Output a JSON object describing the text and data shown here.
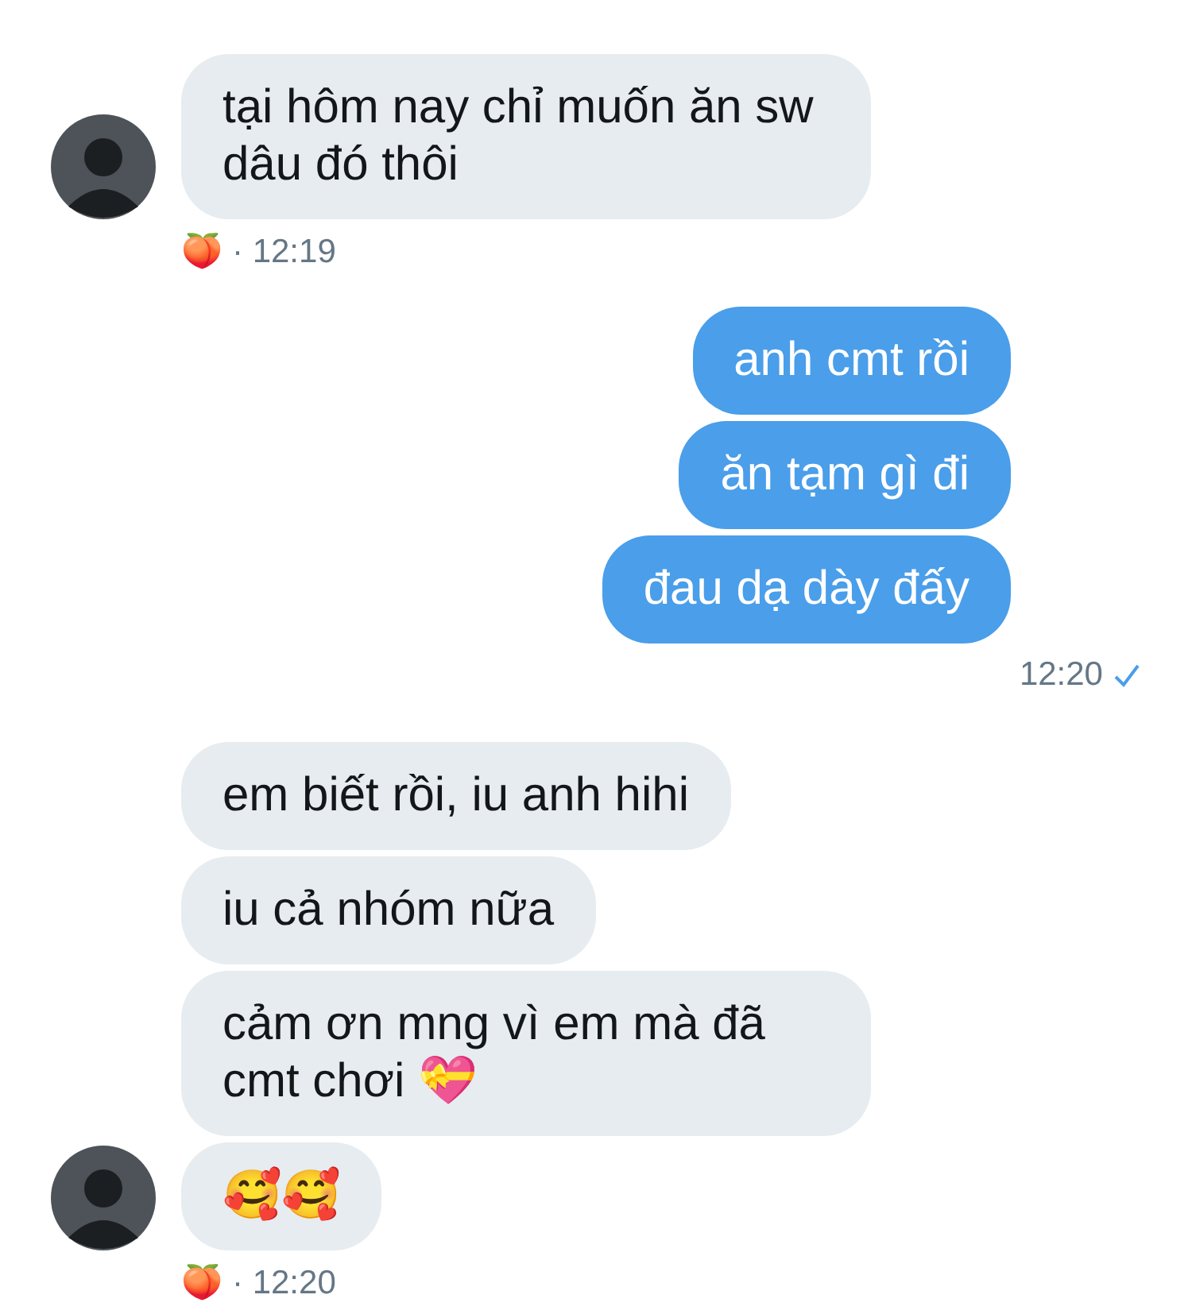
{
  "messages": [
    {
      "kind": "received",
      "bubbles": [
        "tại hôm nay chỉ muốn ăn sw dâu đó thôi"
      ],
      "reaction": "🍑",
      "time": "· 12:19"
    },
    {
      "kind": "sent",
      "bubbles": [
        "anh cmt rồi",
        "ăn tạm gì đi",
        "đau dạ dày đấy"
      ],
      "time": "12:20",
      "read": true
    },
    {
      "kind": "received",
      "bubbles": [
        "em biết rồi, iu anh hihi",
        "iu cả nhóm nữa",
        "cảm ơn mng vì em mà đã cmt chơi 💝",
        "🥰🥰"
      ],
      "reaction": "🍑",
      "time": "· 12:20"
    }
  ]
}
